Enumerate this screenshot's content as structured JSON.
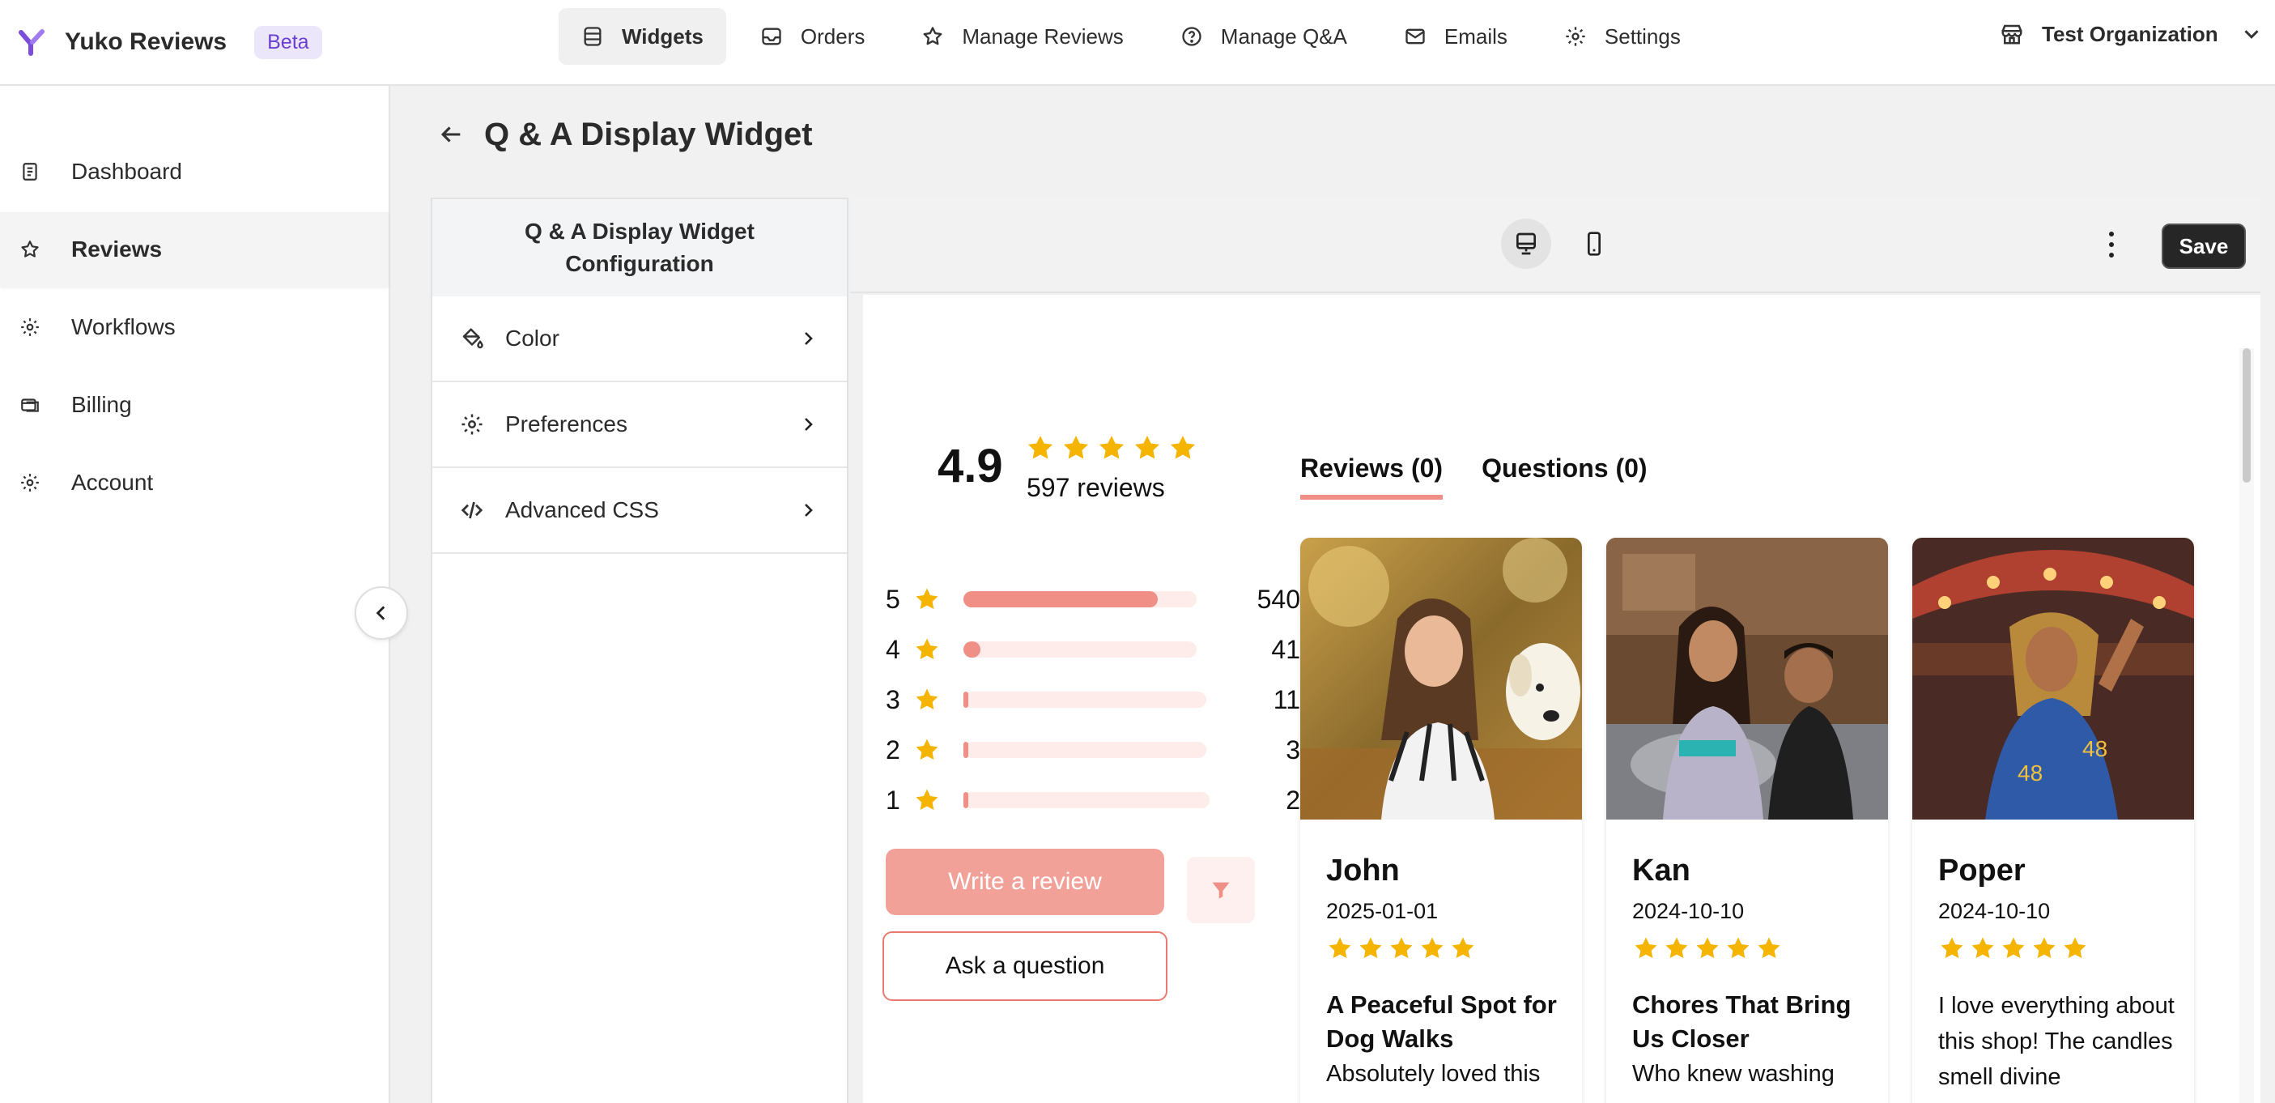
{
  "brand": {
    "name": "Yuko Reviews",
    "badge": "Beta",
    "logo_icon": "yuko-logo-icon",
    "accent": "#6a3fd0"
  },
  "topnav": [
    {
      "label": "Widgets",
      "icon": "widgets-icon",
      "active": true
    },
    {
      "label": "Orders",
      "icon": "inbox-icon"
    },
    {
      "label": "Manage Reviews",
      "icon": "star-icon"
    },
    {
      "label": "Manage Q&A",
      "icon": "question-icon"
    },
    {
      "label": "Emails",
      "icon": "mail-icon"
    },
    {
      "label": "Settings",
      "icon": "gear-icon"
    }
  ],
  "org": {
    "label": "Test Organization",
    "icon": "store-icon"
  },
  "sidebar": {
    "items": [
      {
        "label": "Dashboard",
        "icon": "document-icon"
      },
      {
        "label": "Reviews",
        "icon": "star-icon",
        "active": true
      },
      {
        "label": "Workflows",
        "icon": "gear-icon"
      },
      {
        "label": "Billing",
        "icon": "billing-icon"
      },
      {
        "label": "Account",
        "icon": "gear-icon"
      }
    ]
  },
  "page": {
    "title": "Q & A Display Widget"
  },
  "config": {
    "heading": "Q & A Display Widget Configuration",
    "items": [
      {
        "label": "Color",
        "icon": "paint-bucket-icon"
      },
      {
        "label": "Preferences",
        "icon": "gear-icon"
      },
      {
        "label": "Advanced CSS",
        "icon": "code-icon"
      }
    ]
  },
  "toolbar": {
    "save_label": "Save",
    "active_device": "desktop"
  },
  "widget": {
    "average": "4.9",
    "average_stars": 5,
    "review_count_label": "597 reviews",
    "distribution": [
      {
        "stars": "5",
        "count": "540",
        "fraction": 0.8
      },
      {
        "stars": "4",
        "count": "41",
        "fraction": 0.07
      },
      {
        "stars": "3",
        "count": "11",
        "fraction": 0.02
      },
      {
        "stars": "2",
        "count": "3",
        "fraction": 0.01
      },
      {
        "stars": "1",
        "count": "2",
        "fraction": 0.0
      }
    ],
    "write_review_label": "Write a review",
    "ask_question_label": "Ask a question",
    "tabs": [
      {
        "label": "Reviews (0)",
        "active": true
      },
      {
        "label": "Questions (0)"
      }
    ],
    "accent": "#ef8f86",
    "star_color": "#f5b400",
    "reviews": [
      {
        "name": "John",
        "date": "2025-01-01",
        "rating": 5,
        "title": "A Peaceful Spot for Dog Walks",
        "body": "Absolutely loved this"
      },
      {
        "name": "Kan",
        "date": "2024-10-10",
        "rating": 5,
        "title": "Chores That Bring Us Closer",
        "body": "Who knew washing"
      },
      {
        "name": "Poper",
        "date": "2024-10-10",
        "rating": 5,
        "title": "",
        "body": "I love everything about this shop! The candles smell divine"
      }
    ]
  }
}
